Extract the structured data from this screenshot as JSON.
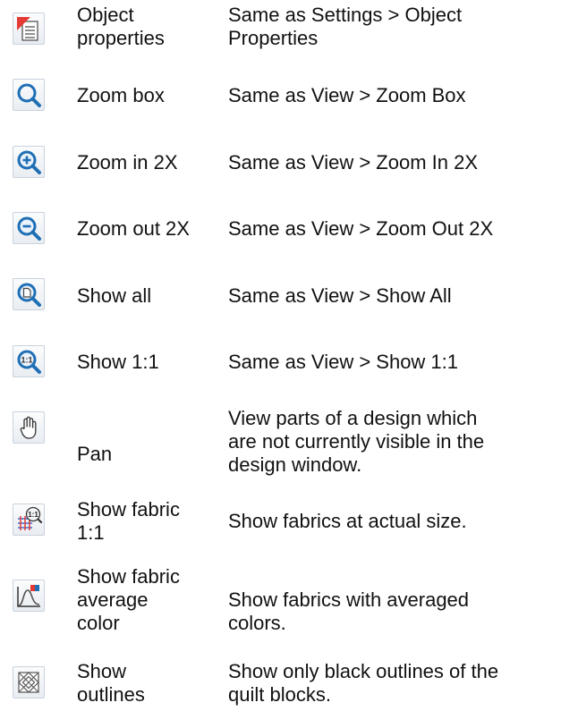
{
  "rows": [
    {
      "icon": "object-properties-icon",
      "name": "Object\nproperties",
      "desc": "Same as Settings > Object\nProperties"
    },
    {
      "icon": "zoom-box-icon",
      "name": "Zoom box",
      "desc": "Same as View > Zoom Box"
    },
    {
      "icon": "zoom-in-icon",
      "name": "Zoom in 2X",
      "desc": "Same as View > Zoom In 2X"
    },
    {
      "icon": "zoom-out-icon",
      "name": "Zoom out 2X",
      "desc": "Same as View > Zoom Out 2X"
    },
    {
      "icon": "show-all-icon",
      "name": "Show all",
      "desc": "Same as View > Show All"
    },
    {
      "icon": "show-1-1-icon",
      "name": "Show 1:1",
      "desc": "Same as View > Show 1:1"
    },
    {
      "icon": "pan-hand-icon",
      "name": "Pan",
      "desc": "View parts of a design which\nare not currently visible in the\ndesign window."
    },
    {
      "icon": "show-fabric-1-1-icon",
      "name": "Show fabric\n1:1",
      "desc": "Show fabrics at actual size."
    },
    {
      "icon": "show-fabric-average-color-icon",
      "name": "Show fabric\naverage\ncolor",
      "desc": "Show fabrics with averaged\ncolors."
    },
    {
      "icon": "show-outlines-icon",
      "name": "Show\noutlines",
      "desc": "Show only black outlines of the\nquilt blocks."
    }
  ],
  "colors": {
    "zoom_blue": "#1f6fb5",
    "accent_red": "#e53935"
  }
}
